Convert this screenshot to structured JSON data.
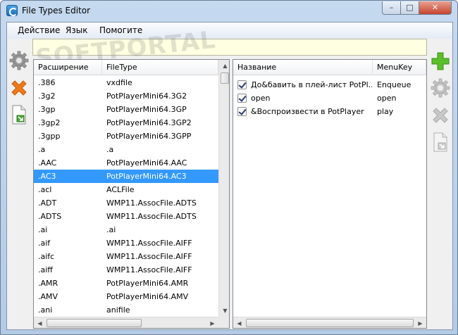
{
  "window": {
    "title": "File Types Editor",
    "controls": {
      "minimize": "–",
      "maximize": "□",
      "close": "✕"
    }
  },
  "menu": {
    "items": [
      "Действие",
      "Язык",
      "Помогите"
    ]
  },
  "watermark": {
    "text": "SOFTPORTAL"
  },
  "left_table": {
    "columns": [
      "Расширение",
      "FileType"
    ],
    "rows": [
      {
        "ext": ".386",
        "type": "vxdfile"
      },
      {
        "ext": ".3g2",
        "type": "PotPlayerMini64.3G2"
      },
      {
        "ext": ".3gp",
        "type": "PotPlayerMini64.3GP"
      },
      {
        "ext": ".3gp2",
        "type": "PotPlayerMini64.3GP2"
      },
      {
        "ext": ".3gpp",
        "type": "PotPlayerMini64.3GPP"
      },
      {
        "ext": ".a",
        "type": ".a"
      },
      {
        "ext": ".AAC",
        "type": "PotPlayerMini64.AAC"
      },
      {
        "ext": ".AC3",
        "type": "PotPlayerMini64.AC3"
      },
      {
        "ext": ".acl",
        "type": "ACLFile"
      },
      {
        "ext": ".ADT",
        "type": "WMP11.AssocFile.ADTS"
      },
      {
        "ext": ".ADTS",
        "type": "WMP11.AssocFile.ADTS"
      },
      {
        "ext": ".ai",
        "type": ".ai"
      },
      {
        "ext": ".aif",
        "type": "WMP11.AssocFile.AIFF"
      },
      {
        "ext": ".aifc",
        "type": "WMP11.AssocFile.AIFF"
      },
      {
        "ext": ".aiff",
        "type": "WMP11.AssocFile.AIFF"
      },
      {
        "ext": ".AMR",
        "type": "PotPlayerMini64.AMR"
      },
      {
        "ext": ".AMV",
        "type": "PotPlayerMini64.AMV"
      },
      {
        "ext": ".ani",
        "type": "anifile"
      }
    ],
    "selected_index": 7
  },
  "right_table": {
    "columns": [
      "Название",
      "MenuKey"
    ],
    "rows": [
      {
        "checked": true,
        "name": "До&бавить в плей-лист PotPl...",
        "key": "Enqueue"
      },
      {
        "checked": true,
        "name": "open",
        "key": "open"
      },
      {
        "checked": true,
        "name": "&Воспроизвести в PotPlayer",
        "key": "play"
      }
    ]
  },
  "icons": {
    "left_toolbar": [
      "gear-icon",
      "delete-x-icon",
      "export-file-icon"
    ],
    "right_toolbar": [
      "add-plus-icon",
      "gear-icon",
      "delete-x-icon",
      "export-file-icon"
    ]
  },
  "colors": {
    "selection": "#3399ff",
    "add_green": "#5bbf2a",
    "delete_orange": "#f07a1a",
    "yellow_bar": "#ffffe1"
  }
}
